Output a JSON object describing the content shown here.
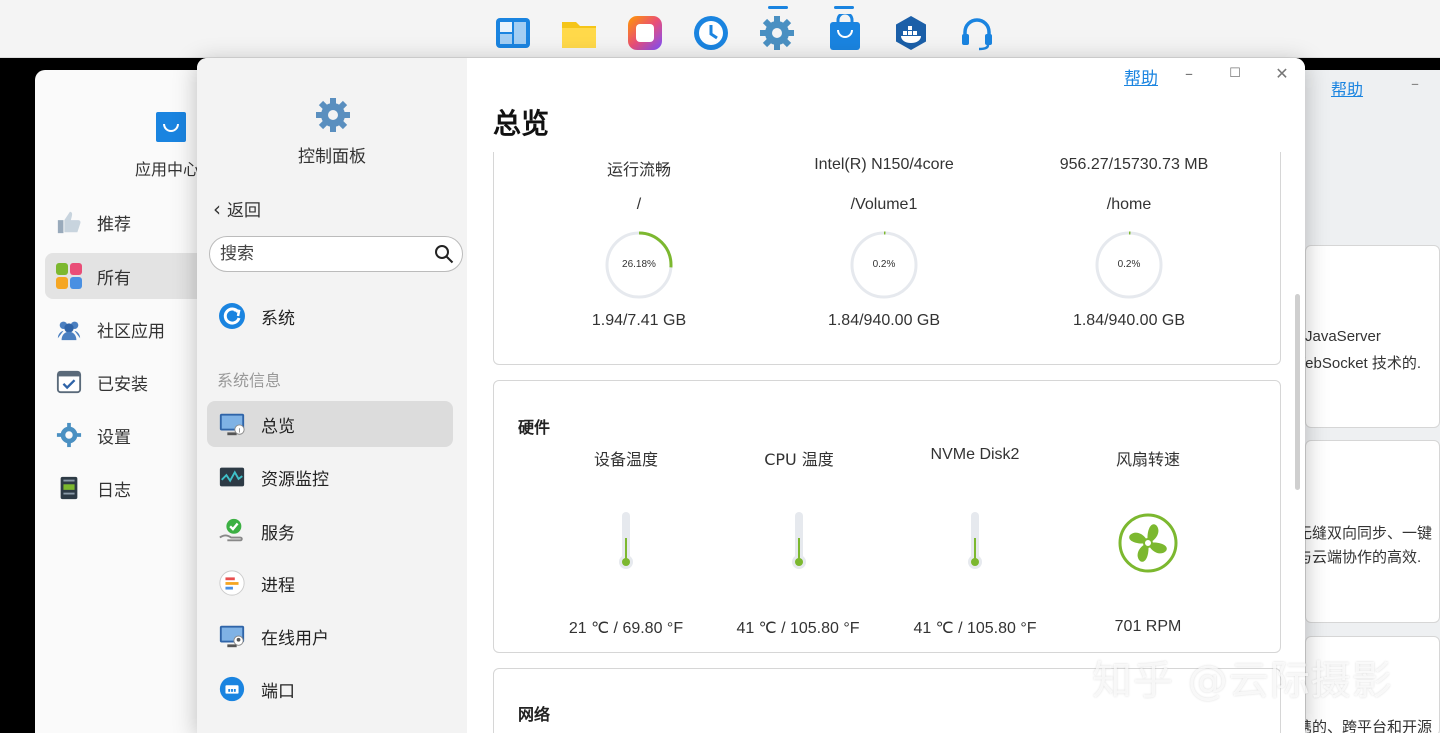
{
  "dock": {
    "icons": [
      {
        "name": "tiles-app-icon",
        "color": "#1a84e0"
      },
      {
        "name": "file-manager-icon",
        "color": "#f5c518"
      },
      {
        "name": "photos-app-icon",
        "color": "#e94e77"
      },
      {
        "name": "backup-clock-icon",
        "color": "#1a84e0"
      },
      {
        "name": "settings-gear-icon",
        "color": "#4a90c2"
      },
      {
        "name": "app-center-bag-icon",
        "color": "#1a84e0"
      },
      {
        "name": "docker-icon",
        "color": "#1b5fa8"
      },
      {
        "name": "support-headset-icon",
        "color": "#1a84e0"
      }
    ]
  },
  "background_window": {
    "title": "应用中心",
    "help_label": "帮助",
    "nav": [
      {
        "label": "推荐",
        "icon": "thumbs-up-icon"
      },
      {
        "label": "所有",
        "icon": "grid-icon",
        "active": true
      },
      {
        "label": "社区应用",
        "icon": "community-icon"
      },
      {
        "label": "已安装",
        "icon": "installed-icon"
      },
      {
        "label": "设置",
        "icon": "settings-icon"
      },
      {
        "label": "日志",
        "icon": "log-icon"
      }
    ],
    "snippets": [
      "JavaServer",
      "/ebSocket 技术的.",
      "无缝双向同步、一键",
      "与云端协作的高效.",
      "携的、跨平台和开源"
    ]
  },
  "window": {
    "app_title": "控制面板",
    "help_label": "帮助",
    "min_label": "–",
    "max_label": "☐",
    "close_label": "✕",
    "back_label": "返回",
    "search_placeholder": "搜索",
    "system_label": "系统",
    "section_label": "系统信息",
    "nav": [
      {
        "label": "总览",
        "icon": "monitor-info-icon",
        "active": true
      },
      {
        "label": "资源监控",
        "icon": "resource-monitor-icon"
      },
      {
        "label": "服务",
        "icon": "service-check-icon"
      },
      {
        "label": "进程",
        "icon": "process-icon"
      },
      {
        "label": "在线用户",
        "icon": "online-users-icon"
      },
      {
        "label": "端口",
        "icon": "port-icon"
      }
    ],
    "page_title": "总览"
  },
  "overview": {
    "top_row": [
      "运行流畅",
      "Intel(R) N150/4core",
      "956.27/15730.73 MB"
    ],
    "volumes": [
      {
        "path": "/",
        "percent": 26.18,
        "percent_label": "26.18%",
        "usage": "1.94/7.41 GB"
      },
      {
        "path": "/Volume1",
        "percent": 0.2,
        "percent_label": "0.2%",
        "usage": "1.84/940.00 GB"
      },
      {
        "path": "/home",
        "percent": 0.2,
        "percent_label": "0.2%",
        "usage": "1.84/940.00 GB"
      }
    ],
    "hardware": {
      "title": "硬件",
      "sensors": [
        {
          "label": "设备温度",
          "value": "21 ℃ / 69.80 °F",
          "type": "thermometer"
        },
        {
          "label": "CPU 温度",
          "value": "41 ℃ / 105.80 °F",
          "type": "thermometer"
        },
        {
          "label": "NVMe Disk2",
          "value": "41 ℃ / 105.80 °F",
          "type": "thermometer"
        },
        {
          "label": "风扇转速",
          "value": "701 RPM",
          "type": "fan"
        }
      ]
    },
    "network": {
      "title": "网络"
    }
  },
  "watermark": "知乎 @云际摄影",
  "colors": {
    "accent": "#1a84e0",
    "gauge": "#7cb82f",
    "gauge_track": "#e6e9ee"
  }
}
